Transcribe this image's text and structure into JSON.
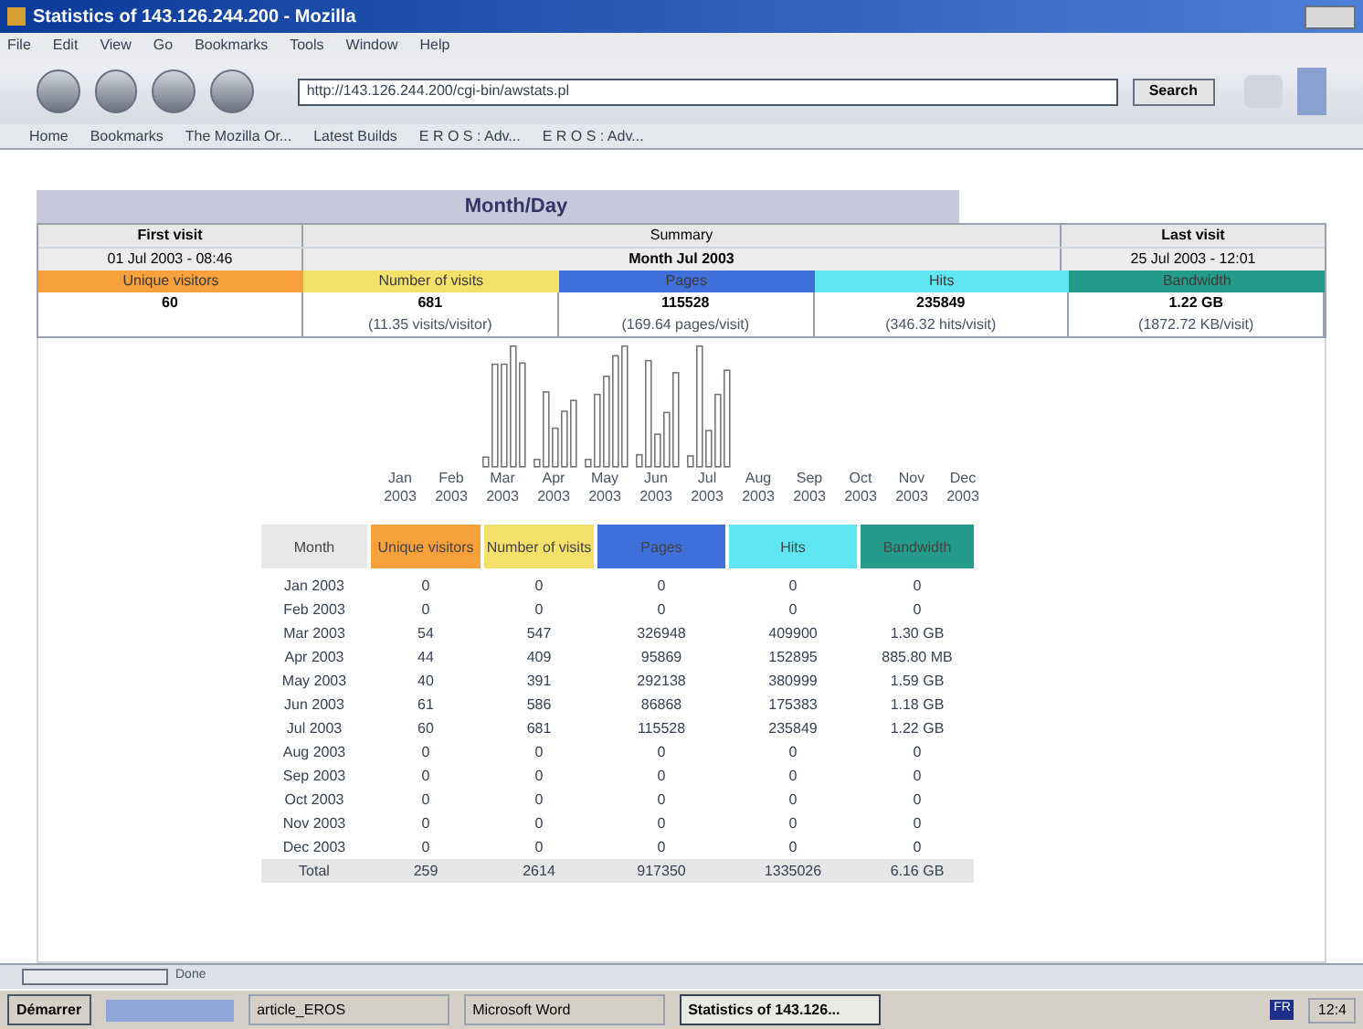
{
  "window": {
    "title": "Statistics of 143.126.244.200 - Mozilla"
  },
  "menu": [
    "File",
    "Edit",
    "View",
    "Go",
    "Bookmarks",
    "Tools",
    "Window",
    "Help"
  ],
  "address": {
    "value": "http://143.126.244.200/cgi-bin/awstats.pl"
  },
  "search_button": "Search",
  "bookmarks": [
    "Home",
    "Bookmarks",
    "The Mozilla Or...",
    "Latest Builds",
    "E R O S : Adv...",
    "E R O S : Adv..."
  ],
  "section_title": "Month/Day",
  "summary": {
    "first_visit_label": "First visit",
    "summary_label": "Summary",
    "last_visit_label": "Last visit",
    "first_visit": "01 Jul 2003 - 08:46",
    "period": "Month Jul 2003",
    "last_visit": "25 Jul 2003 - 12:01",
    "metrics": [
      {
        "label": "Unique visitors",
        "color": "#f7a03c",
        "value": "60"
      },
      {
        "label": "Number of visits",
        "color": "#f5e06a",
        "value": "681",
        "detail": "(11.35 visits/visitor)"
      },
      {
        "label": "Pages",
        "color": "#3f6fd8",
        "value": "115528",
        "detail": "(169.64 pages/visit)"
      },
      {
        "label": "Hits",
        "color": "#5ee6f2",
        "value": "235849",
        "detail": "(346.32 hits/visit)"
      },
      {
        "label": "Bandwidth",
        "color": "#239a8a",
        "value": "1.22 GB",
        "detail": "(1872.72 KB/visit)"
      }
    ]
  },
  "chart_months": [
    [
      "Jan",
      "2003"
    ],
    [
      "Feb",
      "2003"
    ],
    [
      "Mar",
      "2003"
    ],
    [
      "Apr",
      "2003"
    ],
    [
      "May",
      "2003"
    ],
    [
      "Jun",
      "2003"
    ],
    [
      "Jul",
      "2003"
    ],
    [
      "Aug",
      "2003"
    ],
    [
      "Sep",
      "2003"
    ],
    [
      "Oct",
      "2003"
    ],
    [
      "Nov",
      "2003"
    ],
    [
      "Dec",
      "2003"
    ]
  ],
  "table": {
    "columns": [
      {
        "label": "Month",
        "color": "#e8e8e8"
      },
      {
        "label": "Unique visitors",
        "color": "#f7a03c"
      },
      {
        "label": "Number of visits",
        "color": "#f5e06a"
      },
      {
        "label": "Pages",
        "color": "#3f6fd8"
      },
      {
        "label": "Hits",
        "color": "#5ee6f2"
      },
      {
        "label": "Bandwidth",
        "color": "#239a8a"
      }
    ],
    "rows": [
      [
        "Jan 2003",
        "0",
        "0",
        "0",
        "0",
        "0"
      ],
      [
        "Feb 2003",
        "0",
        "0",
        "0",
        "0",
        "0"
      ],
      [
        "Mar 2003",
        "54",
        "547",
        "326948",
        "409900",
        "1.30 GB"
      ],
      [
        "Apr 2003",
        "44",
        "409",
        "95869",
        "152895",
        "885.80 MB"
      ],
      [
        "May 2003",
        "40",
        "391",
        "292138",
        "380999",
        "1.59 GB"
      ],
      [
        "Jun 2003",
        "61",
        "586",
        "86868",
        "175383",
        "1.18 GB"
      ],
      [
        "Jul 2003",
        "60",
        "681",
        "115528",
        "235849",
        "1.22 GB"
      ],
      [
        "Aug 2003",
        "0",
        "0",
        "0",
        "0",
        "0"
      ],
      [
        "Sep 2003",
        "0",
        "0",
        "0",
        "0",
        "0"
      ],
      [
        "Oct 2003",
        "0",
        "0",
        "0",
        "0",
        "0"
      ],
      [
        "Nov 2003",
        "0",
        "0",
        "0",
        "0",
        "0"
      ],
      [
        "Dec 2003",
        "0",
        "0",
        "0",
        "0",
        "0"
      ]
    ],
    "total": [
      "Total",
      "259",
      "2614",
      "917350",
      "1335026",
      "6.16 GB"
    ]
  },
  "status_bar": "Done",
  "taskbar": {
    "start": "Démarrer",
    "items": [
      {
        "label": "article_EROS",
        "selected": false
      },
      {
        "label": "Microsoft Word",
        "selected": false
      },
      {
        "label": "Statistics of 143.126...",
        "selected": true
      }
    ],
    "language": "FR",
    "clock": "12:4"
  }
}
